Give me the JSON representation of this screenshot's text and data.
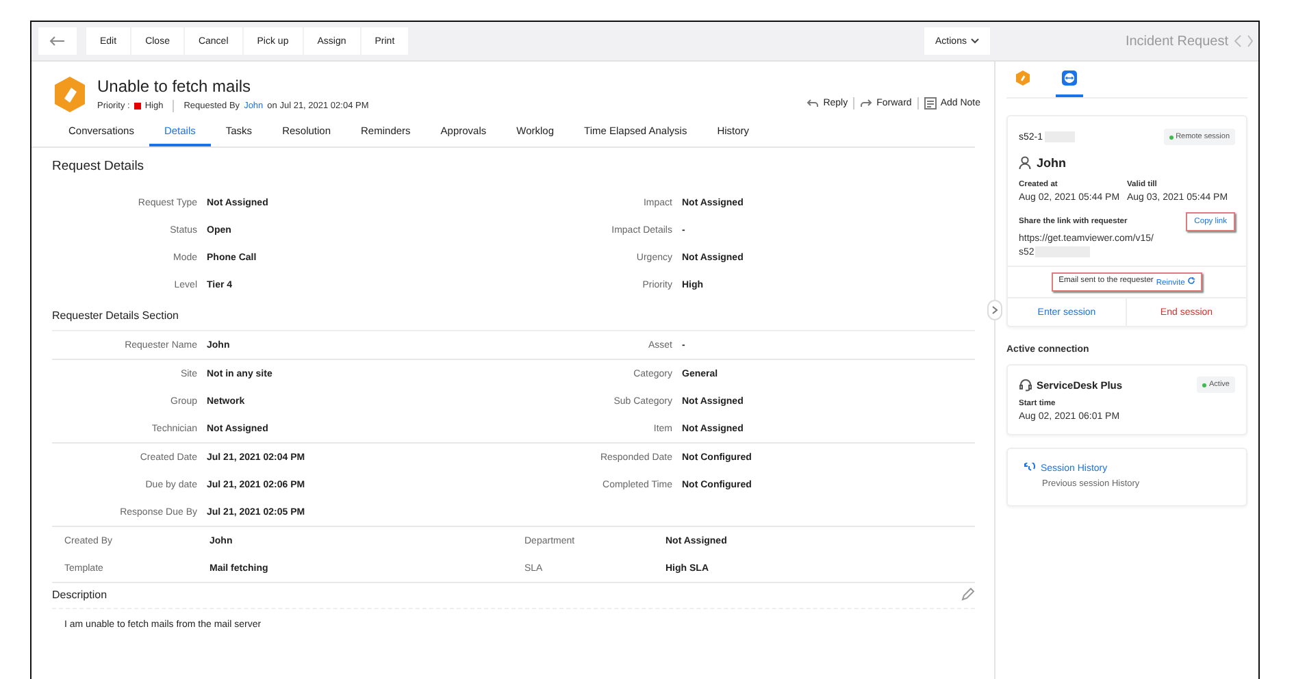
{
  "toolbar": {
    "buttons": [
      "Edit",
      "Close",
      "Cancel",
      "Pick up",
      "Assign",
      "Print"
    ],
    "actions": "Actions",
    "header_title": "Incident Request"
  },
  "request": {
    "title": "Unable to fetch mails",
    "priority_label": "Priority :",
    "priority": "High",
    "requested_by": "Requested By",
    "requester": "John",
    "date_text": "on Jul 21, 2021 02:04 PM"
  },
  "reply_actions": [
    {
      "kind": "reply",
      "label": "Reply"
    },
    {
      "kind": "forward",
      "label": "Forward"
    },
    {
      "kind": "note",
      "label": "Add Note"
    }
  ],
  "tabs": [
    {
      "label": "Conversations",
      "selected": false
    },
    {
      "label": "Details",
      "selected": true
    },
    {
      "label": "Tasks",
      "selected": false
    },
    {
      "label": "Resolution",
      "selected": false
    },
    {
      "label": "Reminders",
      "selected": false
    },
    {
      "label": "Approvals",
      "selected": false
    },
    {
      "label": "Worklog",
      "selected": false
    },
    {
      "label": "Time Elapsed Analysis",
      "selected": false
    },
    {
      "label": "History",
      "selected": false
    }
  ],
  "request_details": {
    "title": "Request Details",
    "rows": [
      [
        {
          "label": "Request Type",
          "value": "Not Assigned"
        },
        {
          "label": "Impact",
          "value": "Not Assigned"
        }
      ],
      [
        {
          "label": "Status",
          "value": "Open"
        },
        {
          "label": "Impact Details",
          "value": "-"
        }
      ],
      [
        {
          "label": "Mode",
          "value": "Phone Call"
        },
        {
          "label": "Urgency",
          "value": "Not Assigned"
        }
      ],
      [
        {
          "label": "Level",
          "value": "Tier 4"
        },
        {
          "label": "Priority",
          "value": "High"
        }
      ]
    ]
  },
  "requester_section": {
    "title": "Requester Details Section",
    "groups": [
      {
        "kind": "aligned",
        "rows": [
          [
            {
              "label": "Requester Name",
              "value": "John"
            },
            {
              "label": "Asset",
              "value": "-"
            }
          ]
        ]
      },
      {
        "kind": "aligned",
        "rows": [
          [
            {
              "label": "Site",
              "value": "Not in any site"
            },
            {
              "label": "Category",
              "value": "General"
            }
          ],
          [
            {
              "label": "Group",
              "value": "Network"
            },
            {
              "label": "Sub Category",
              "value": "Not Assigned"
            }
          ],
          [
            {
              "label": "Technician",
              "value": "Not Assigned"
            },
            {
              "label": "Item",
              "value": "Not Assigned"
            }
          ]
        ]
      },
      {
        "kind": "aligned",
        "rows": [
          [
            {
              "label": "Created Date",
              "value": "Jul 21, 2021 02:04 PM"
            },
            {
              "label": "Responded Date",
              "value": "Not Configured"
            }
          ],
          [
            {
              "label": "Due by date",
              "value": "Jul 21, 2021 02:06 PM"
            },
            {
              "label": "Completed Time",
              "value": "Not Configured"
            }
          ],
          [
            {
              "label": "Response Due By",
              "value": "Jul 21, 2021 02:05 PM"
            }
          ]
        ]
      },
      {
        "kind": "plain",
        "rows": [
          [
            {
              "label": "Created By",
              "value": "John"
            },
            {
              "label": "Department",
              "value": "Not Assigned"
            }
          ],
          [
            {
              "label": "Template",
              "value": "Mail fetching"
            },
            {
              "label": "SLA",
              "value": "High SLA"
            }
          ]
        ]
      }
    ]
  },
  "description": {
    "title": "Description",
    "text": "I am unable to fetch mails from the mail server"
  },
  "side_tabs": [
    {
      "kind": "app",
      "selected": false
    },
    {
      "kind": "remote",
      "selected": true
    }
  ],
  "session": {
    "id": "s52-1",
    "badge": "Remote session",
    "user": "John",
    "created_label": "Created at",
    "created": "Aug 02, 2021 05:44 PM",
    "valid_label": "Valid till",
    "valid": "Aug 03, 2021 05:44 PM",
    "share_label": "Share the link with requester",
    "copy_link": "Copy link",
    "link_lines": [
      "https://get.teamviewer.com/v15/",
      "s52"
    ],
    "email_note": "Email sent to the requester",
    "reinvite": "Reinvite",
    "enter": "Enter session",
    "end": "End session"
  },
  "active_connection": {
    "title": "Active connection",
    "name": "ServiceDesk Plus",
    "status": "Active",
    "start_label": "Start time",
    "start": "Aug 02, 2021 06:01 PM"
  },
  "session_history": {
    "title": "Session History",
    "subtitle": "Previous session History"
  }
}
